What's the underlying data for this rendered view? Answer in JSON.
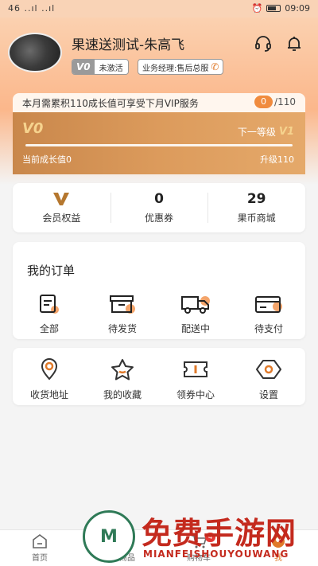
{
  "status_bar": {
    "signal": "46 ..ıl ..ıl",
    "time": "09:09"
  },
  "profile": {
    "username": "果速送测试-朱高飞",
    "level_tag": "V0",
    "level_status": "未激活",
    "manager_label": "业务经理:售后总服"
  },
  "growth": {
    "notice": "本月需累积110成长值可享受下月VIP服务",
    "current_value": "0",
    "target_value": "/110"
  },
  "vip_card": {
    "current_level": "V0",
    "next_level_label": "下一等级",
    "next_level": "V1",
    "current_growth": "当前成长值0",
    "upgrade_text": "升级110",
    "progress_fraction": 0
  },
  "stats": [
    {
      "value": "",
      "label": "会员权益"
    },
    {
      "value": "0",
      "label": "优惠券"
    },
    {
      "value": "29",
      "label": "果币商城"
    }
  ],
  "orders": {
    "title": "我的订单",
    "items": [
      {
        "label": "全部",
        "icon": "all-orders-icon"
      },
      {
        "label": "待发货",
        "icon": "pending-shipment-icon"
      },
      {
        "label": "配送中",
        "icon": "delivery-truck-icon"
      },
      {
        "label": "待支付",
        "icon": "pending-payment-icon"
      }
    ]
  },
  "tools": [
    {
      "label": "收货地址",
      "icon": "location-pin-icon"
    },
    {
      "label": "我的收藏",
      "icon": "star-icon"
    },
    {
      "label": "领券中心",
      "icon": "coupon-icon"
    },
    {
      "label": "设置",
      "icon": "settings-icon"
    }
  ],
  "tabbar": {
    "tabs": [
      {
        "label": "首页"
      },
      {
        "label": "全部商品"
      },
      {
        "label": "购物车",
        "badge": "4"
      },
      {
        "label": "我"
      }
    ]
  },
  "watermark": {
    "main": "免费手游网",
    "sub": "MIANFEISHOUYOUWANG"
  },
  "colors": {
    "accent": "#e07a2a",
    "card_gold": "#d4934f",
    "header_peach": "#fbc49c"
  }
}
